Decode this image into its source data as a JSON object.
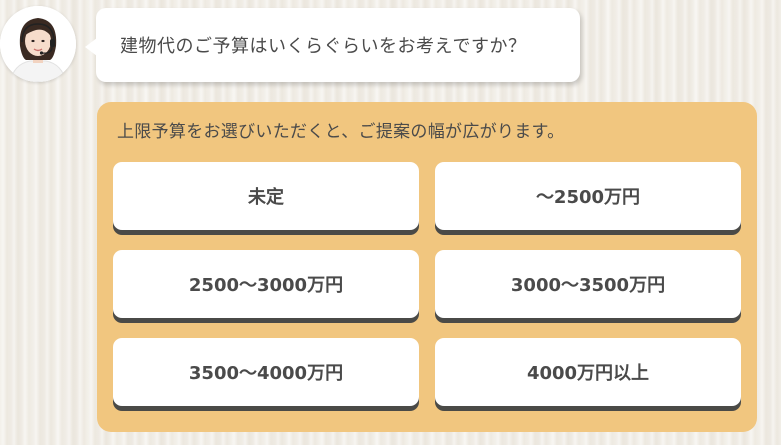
{
  "operator": {
    "icon": "operator-avatar-icon"
  },
  "question": {
    "text": "建物代のご予算はいくらぐらいをお考えですか？"
  },
  "panel": {
    "hint": "上限予算をお選びいただくと、ご提案の幅が広がります。",
    "background_color": "#f1c67f"
  },
  "options": [
    {
      "label": "未定"
    },
    {
      "label": "～2500万円"
    },
    {
      "label": "2500～3000万円"
    },
    {
      "label": "3000～3500万円"
    },
    {
      "label": "3500～4000万円"
    },
    {
      "label": "4000万円以上"
    }
  ]
}
